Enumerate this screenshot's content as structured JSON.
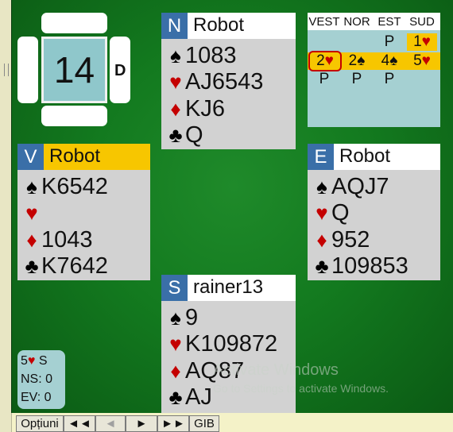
{
  "trick_counter": {
    "count": "14",
    "dealer_label": "D"
  },
  "hands": {
    "north": {
      "seat": "N",
      "player": "Robot",
      "spades": "1083",
      "hearts": "AJ6543",
      "diamonds": "KJ6",
      "clubs": "Q"
    },
    "west": {
      "seat": "V",
      "player": "Robot",
      "active": true,
      "spades": "K6542",
      "hearts": "",
      "diamonds": "1043",
      "clubs": "K7642"
    },
    "east": {
      "seat": "E",
      "player": "Robot",
      "spades": "AQJ7",
      "hearts": "Q",
      "diamonds": "952",
      "clubs": "109853"
    },
    "south": {
      "seat": "S",
      "player": "rainer13",
      "spades": "9",
      "hearts": "K109872",
      "diamonds": "AQ87",
      "clubs": "AJ"
    }
  },
  "suit_symbols": {
    "spades": "♠",
    "hearts": "♥",
    "diamonds": "♦",
    "clubs": "♣"
  },
  "bidding": {
    "headers": [
      "VEST",
      "NOR",
      "EST",
      "SUD"
    ],
    "rows": [
      [
        "",
        "",
        "P",
        "1♥"
      ],
      [
        "2♥",
        "2♠",
        "4♠",
        "5♥"
      ],
      [
        "P",
        "P",
        "P",
        ""
      ]
    ]
  },
  "score": {
    "contract_level": "5",
    "contract_suit": "♥",
    "declarer": "S",
    "ns": "NS: 0",
    "ev": "EV: 0"
  },
  "watermark": {
    "line1": "Activate Windows",
    "line2": "Go to Settings to activate Windows."
  },
  "toolbar": {
    "options": "Opțiuni",
    "first": "◄◄",
    "prev": "◄",
    "next": "►",
    "last": "►►",
    "gib": "GIB"
  },
  "colors": {
    "felt": "#137a1f",
    "seat_badge": "#3a6fa8",
    "active_header": "#f7c600",
    "red_suit": "#c40000"
  }
}
